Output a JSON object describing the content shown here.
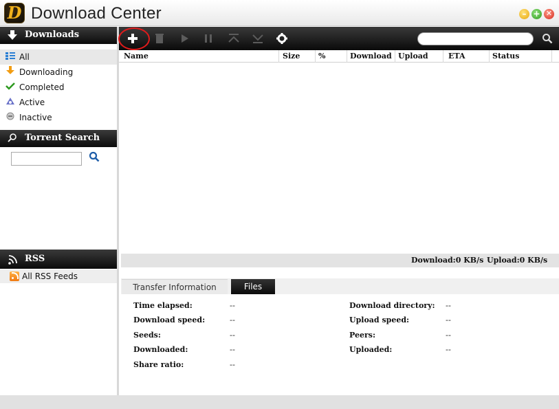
{
  "window": {
    "logo_letter": "D",
    "title": "Download Center",
    "buttons": {
      "minimize": "–",
      "maximize": "+",
      "close": "✕"
    }
  },
  "sidebar": {
    "downloads_header": "Downloads",
    "filters": [
      {
        "label": "All",
        "icon": "list-icon"
      },
      {
        "label": "Downloading",
        "icon": "down-arrow-icon"
      },
      {
        "label": "Completed",
        "icon": "checkmark-icon"
      },
      {
        "label": "Active",
        "icon": "active-icon"
      },
      {
        "label": "Inactive",
        "icon": "inactive-icon"
      }
    ],
    "torrent_search_header": "Torrent Search",
    "torrent_search": {
      "value": "",
      "placeholder": ""
    },
    "rss_header": "RSS",
    "rss_feeds": [
      {
        "label": "All RSS Feeds"
      }
    ]
  },
  "toolbar": {
    "buttons": [
      "add-icon",
      "remove-icon",
      "play-icon",
      "pause-icon",
      "move-up-icon",
      "move-down-icon",
      "settings-icon"
    ],
    "search": {
      "value": "",
      "placeholder": ""
    }
  },
  "table": {
    "columns": [
      "Name",
      "Size",
      "%",
      "Download",
      "Upload",
      "ETA",
      "Status"
    ],
    "rows": []
  },
  "speeds": {
    "download": "Download:0 KB/s",
    "upload": "Upload:0 KB/s"
  },
  "details": {
    "tabs": [
      "Transfer Information",
      "Files"
    ],
    "left": [
      {
        "label": "Time elapsed:",
        "value": "--"
      },
      {
        "label": "Download speed:",
        "value": "--"
      },
      {
        "label": "Seeds:",
        "value": "--"
      },
      {
        "label": "Downloaded:",
        "value": "--"
      },
      {
        "label": "Share ratio:",
        "value": "--"
      }
    ],
    "right": [
      {
        "label": "Download directory:",
        "value": "--"
      },
      {
        "label": "Upload speed:",
        "value": "--"
      },
      {
        "label": "Peers:",
        "value": "--"
      },
      {
        "label": "Uploaded:",
        "value": "--"
      }
    ]
  },
  "colors": {
    "toolbar_bg": "#111111",
    "highlight_circle": "#e11b1b",
    "accent_blue": "#1d5da8"
  }
}
